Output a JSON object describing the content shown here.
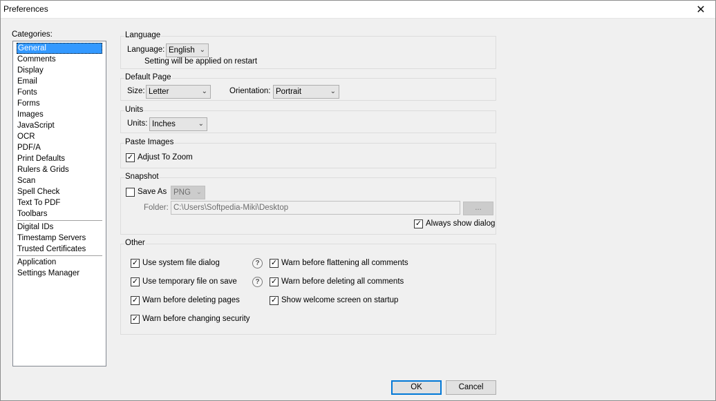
{
  "window": {
    "title": "Preferences",
    "close_glyph": "✕"
  },
  "categories": {
    "label": "Categories:",
    "groups": [
      [
        "General",
        "Comments",
        "Display",
        "Email",
        "Fonts",
        "Forms",
        "Images",
        "JavaScript",
        "OCR",
        "PDF/A",
        "Print Defaults",
        "Rulers & Grids",
        "Scan",
        "Spell Check",
        "Text To PDF",
        "Toolbars"
      ],
      [
        "Digital IDs",
        "Timestamp Servers",
        "Trusted Certificates"
      ],
      [
        "Application",
        "Settings Manager"
      ]
    ],
    "selected": "General"
  },
  "language": {
    "title": "Language",
    "label": "Language:",
    "value": "English",
    "note": "Setting will be applied on restart"
  },
  "default_page": {
    "title": "Default Page",
    "size_label": "Size:",
    "size_value": "Letter",
    "orientation_label": "Orientation:",
    "orientation_value": "Portrait"
  },
  "units": {
    "title": "Units",
    "label": "Units:",
    "value": "Inches"
  },
  "paste_images": {
    "title": "Paste Images",
    "adjust_label": "Adjust To Zoom",
    "adjust_checked": true
  },
  "snapshot": {
    "title": "Snapshot",
    "save_as_label": "Save As",
    "save_as_checked": false,
    "format_value": "PNG",
    "folder_label": "Folder:",
    "folder_value": "C:\\Users\\Softpedia-Miki\\Desktop",
    "browse_label": "...",
    "always_show_label": "Always show dialog",
    "always_show_checked": true
  },
  "other": {
    "title": "Other",
    "use_system_file_dialog": "Use system file dialog",
    "use_temporary_file": "Use temporary file on save",
    "warn_deleting_pages": "Warn before deleting pages",
    "warn_changing_security": "Warn before changing security",
    "warn_flattening": "Warn before flattening all comments",
    "warn_deleting_comments": "Warn before deleting all comments",
    "show_welcome": "Show welcome screen on startup",
    "help_glyph": "?",
    "check_glyph": "✓"
  },
  "buttons": {
    "ok": "OK",
    "cancel": "Cancel"
  },
  "colors": {
    "selection": "#3399ff",
    "default_button_border": "#0078d7",
    "window_bg": "#f0f0f0"
  },
  "icons": {
    "close": "close-icon",
    "chevron": "chevron-down-icon",
    "help": "help-icon",
    "check": "checkmark-icon"
  }
}
